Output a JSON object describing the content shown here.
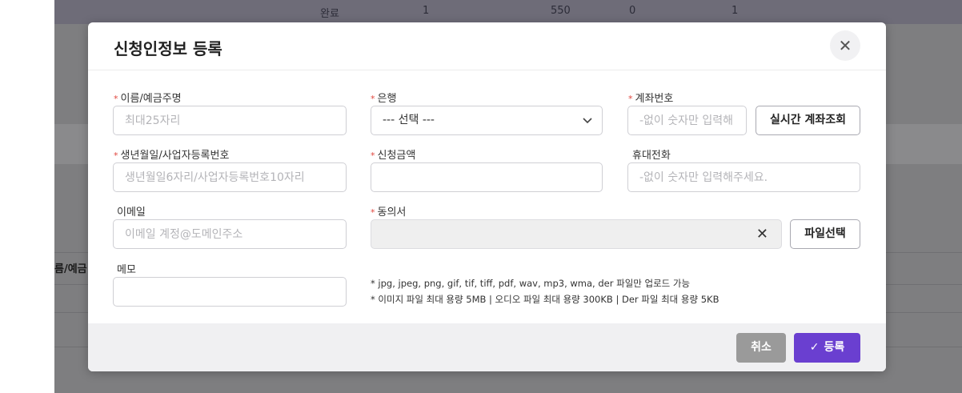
{
  "background": {
    "top_row": [
      "완료",
      "1",
      "550",
      "0",
      "1"
    ],
    "left_label": "름/예금",
    "left_tick_1": "t",
    "left_tick_2": "t"
  },
  "modal": {
    "title": "신청인정보 등록",
    "close_icon": "close-icon",
    "fields": {
      "name": {
        "label": "이름/예금주명",
        "required": true,
        "placeholder": "최대25자리"
      },
      "bank": {
        "label": "은행",
        "required": true,
        "selected": "--- 선택 ---"
      },
      "account": {
        "label": "계좌번호",
        "required": true,
        "placeholder": "-없이 숫자만 입력해",
        "lookup_button": "실시간 계좌조회"
      },
      "birth": {
        "label": "생년월일/사업자등록번호",
        "required": true,
        "placeholder": "생년월일6자리/사업자등록번호10자리"
      },
      "amount": {
        "label": "신청금액",
        "required": true,
        "placeholder": ""
      },
      "phone": {
        "label": "휴대전화",
        "required": false,
        "placeholder": "-없이 숫자만 입력해주세요."
      },
      "email": {
        "label": "이메일",
        "required": false,
        "placeholder": "이메일 계정@도메인주소"
      },
      "consent": {
        "label": "동의서",
        "required": true,
        "file_button": "파일선택"
      },
      "memo": {
        "label": "메모",
        "required": false,
        "placeholder": ""
      }
    },
    "notes": [
      "* jpg, jpeg, png, gif, tif, tiff, pdf, wav, mp3, wma, der 파일만 업로드 가능",
      "* 이미지 파일 최대 용량 5MB | 오디오 파일 최대 용량 300KB | Der 파일 최대 용량 5KB"
    ],
    "footer": {
      "cancel_label": "취소",
      "submit_label": "등록"
    },
    "required_mark": "*",
    "accent_color": "#6a3fd0"
  }
}
